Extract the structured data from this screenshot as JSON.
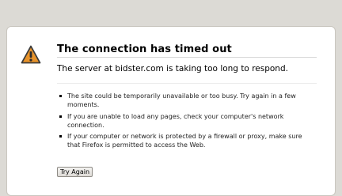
{
  "error": {
    "icon": "warning-triangle-icon",
    "accent_color": "#e8932a",
    "title": "The connection has timed out",
    "subtitle": "The server at bidster.com is taking too long to respond.",
    "bullets": [
      "The site could be temporarily unavailable or too busy. Try again in a few moments.",
      "If you are unable to load any pages, check your computer's network connection.",
      "If your computer or network is protected by a firewall or proxy, make sure that Firefox is permitted to access the Web."
    ],
    "button_label": "Try Again"
  }
}
